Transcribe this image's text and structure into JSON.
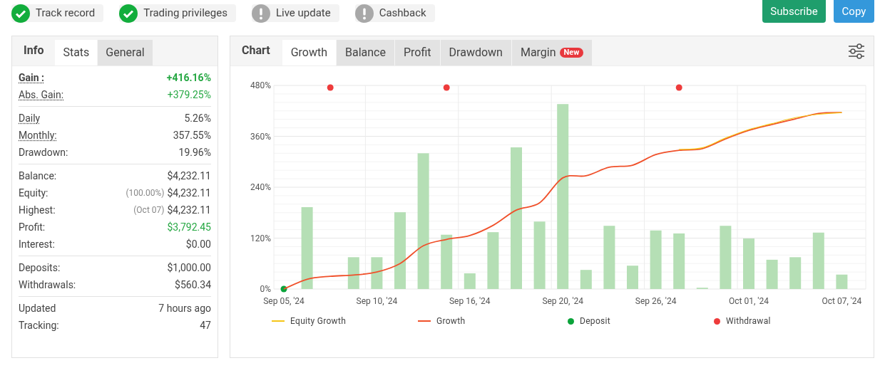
{
  "badges": [
    {
      "label": "Track record",
      "ok": true
    },
    {
      "label": "Trading privileges",
      "ok": true
    },
    {
      "label": "Live update",
      "ok": false
    },
    {
      "label": "Cashback",
      "ok": false
    }
  ],
  "actions": [
    {
      "label": "Subscribe",
      "kind": "subscribe"
    },
    {
      "label": "Copy",
      "kind": "copy"
    }
  ],
  "stats_panel": {
    "heading": "Info",
    "tabs": [
      {
        "label": "Stats",
        "selected": true
      },
      {
        "label": "General",
        "selected": false
      }
    ],
    "groups": [
      [
        {
          "label": "Gain :",
          "value": "+416.16%",
          "underlined": true,
          "emphasis": true,
          "color": "#27a844"
        },
        {
          "label": "Abs. Gain:",
          "value": "+379.25%",
          "underlined": true,
          "emphasis": false,
          "color": "#27a844"
        }
      ],
      [
        {
          "label": "Daily",
          "value": "5.26%",
          "underlined": true,
          "emphasis": false
        },
        {
          "label": "Monthly:",
          "value": "357.55%",
          "underlined": true,
          "emphasis": false
        },
        {
          "label": "Drawdown:",
          "value": "19.96%",
          "underlined": false,
          "emphasis": false
        }
      ],
      [
        {
          "label": "Balance:",
          "value": "$4,232.11",
          "underlined": false,
          "emphasis": false
        },
        {
          "label": "Equity:",
          "note": "(100.00%)",
          "value": "$4,232.11",
          "underlined": false,
          "emphasis": false
        },
        {
          "label": "Highest:",
          "note": "(Oct 07)",
          "value": "$4,232.11",
          "underlined": false,
          "emphasis": false
        },
        {
          "label": "Profit:",
          "value": "$3,792.45",
          "underlined": false,
          "emphasis": false,
          "color": "#27a844"
        },
        {
          "label": "Interest:",
          "value": "$0.00",
          "underlined": false,
          "emphasis": false
        }
      ],
      [
        {
          "label": "Deposits:",
          "value": "$1,000.00",
          "underlined": false,
          "emphasis": false
        },
        {
          "label": "Withdrawals:",
          "value": "$560.34",
          "underlined": false,
          "emphasis": false
        }
      ],
      [
        {
          "label": "Updated",
          "value": "7 hours ago",
          "underlined": false,
          "emphasis": false
        },
        {
          "label": "Tracking:",
          "value": "47",
          "underlined": false,
          "emphasis": false
        }
      ]
    ]
  },
  "chart_panel": {
    "heading": "Chart",
    "tabs": [
      {
        "label": "Growth",
        "selected": true
      },
      {
        "label": "Balance",
        "selected": false
      },
      {
        "label": "Profit",
        "selected": false
      },
      {
        "label": "Drawdown",
        "selected": false
      },
      {
        "label": "Margin",
        "selected": false,
        "badge": "New"
      }
    ],
    "chart_data": {
      "type": "line",
      "categories": [
        "Sep 05, '24",
        null,
        null,
        null,
        "Sep 10, '24",
        null,
        null,
        null,
        "Sep 16, '24",
        null,
        null,
        null,
        "Sep 20, '24",
        null,
        null,
        null,
        "Sep 26, '24",
        null,
        null,
        null,
        "Oct 01, '24",
        null,
        null,
        null,
        "Oct 07, '24"
      ],
      "ylim": [
        0,
        480
      ],
      "grid": true,
      "yticks": [
        {
          "value": 0,
          "label": "0%"
        },
        {
          "value": 120,
          "label": "120%"
        },
        {
          "value": 240,
          "label": "240%"
        },
        {
          "value": 360,
          "label": "360%"
        },
        {
          "value": 480,
          "label": "480%"
        }
      ],
      "series": [
        {
          "type": "bar",
          "color": "#b5dfb5",
          "values": [
            null,
            193,
            null,
            75,
            75,
            181,
            320,
            128,
            37,
            134,
            334,
            159,
            436,
            45,
            149,
            55,
            138,
            131,
            3,
            149,
            119,
            69,
            75,
            133,
            34
          ]
        },
        {
          "name": "Equity Growth",
          "color": "#f5c518",
          "type": "line",
          "values": [
            null,
            null,
            null,
            null,
            null,
            null,
            null,
            null,
            null,
            null,
            null,
            null,
            null,
            null,
            null,
            null,
            null,
            329,
            333,
            356,
            376,
            390,
            404,
            412,
            416
          ]
        },
        {
          "name": "Growth",
          "color": "#f0502a",
          "type": "line",
          "values": [
            0,
            23,
            30,
            33,
            40,
            60,
            102,
            117,
            126,
            150,
            186,
            203,
            262,
            267,
            287,
            292,
            317,
            327,
            331,
            354,
            374,
            388,
            401,
            414,
            416
          ]
        },
        {
          "name": "Deposit",
          "color": "#0aa33a",
          "type": "scatter",
          "marker": "circle",
          "values": [
            0,
            null,
            null,
            null,
            null,
            null,
            null,
            null,
            null,
            null,
            null,
            null,
            null,
            null,
            null,
            null,
            null,
            null,
            null,
            null,
            null,
            null,
            null,
            null,
            null
          ]
        },
        {
          "name": "Withdrawal",
          "color": "#ee3b3b",
          "type": "scatter",
          "marker": "circle",
          "values": [
            null,
            null,
            475,
            null,
            null,
            null,
            null,
            475,
            null,
            null,
            null,
            null,
            null,
            null,
            null,
            null,
            null,
            475,
            null,
            null,
            null,
            null,
            null,
            null,
            null
          ]
        }
      ]
    }
  }
}
